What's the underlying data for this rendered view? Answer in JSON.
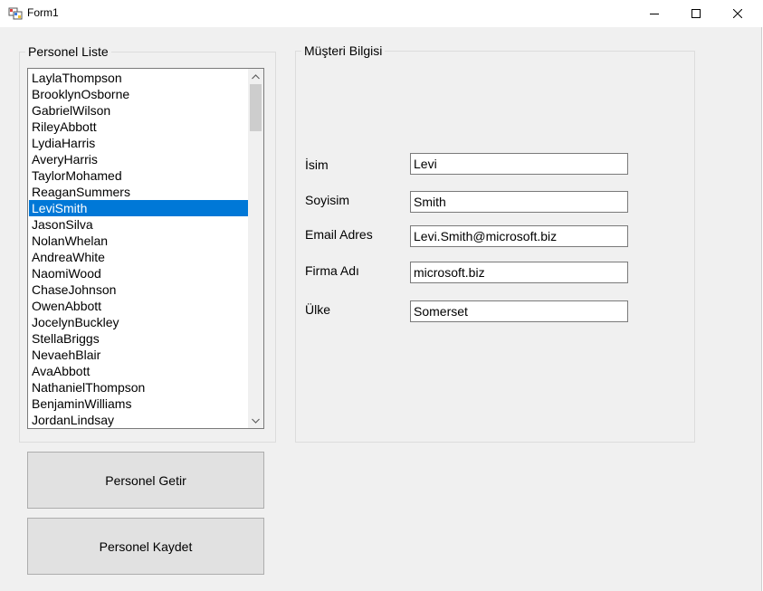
{
  "window": {
    "title": "Form1"
  },
  "personel_group": {
    "label": "Personel Liste",
    "items": [
      "LaylaThompson",
      "BrooklynOsborne",
      "GabrielWilson",
      "RileyAbbott",
      "LydiaHarris",
      "AveryHarris",
      "TaylorMohamed",
      "ReaganSummers",
      "LeviSmith",
      "JasonSilva",
      "NolanWhelan",
      "AndreaWhite",
      "NaomiWood",
      "ChaseJohnson",
      "OwenAbbott",
      "JocelynBuckley",
      "StellaBriggs",
      "NevaehBlair",
      "AvaAbbott",
      "NathanielThompson",
      "BenjaminWilliams",
      "JordanLindsay"
    ],
    "selected_item": "LeviSmith"
  },
  "musteri_group": {
    "label": "Müşteri Bilgisi",
    "fields": {
      "isim": {
        "label": "İsim",
        "value": "Levi"
      },
      "soyisim": {
        "label": "Soyisim",
        "value": "Smith"
      },
      "email": {
        "label": "Email Adres",
        "value": "Levi.Smith@microsoft.biz"
      },
      "firma": {
        "label": "Firma Adı",
        "value": "microsoft.biz"
      },
      "ulke": {
        "label": "Ülke",
        "value": "Somerset"
      }
    }
  },
  "buttons": {
    "getir": "Personel Getir",
    "kaydet": "Personel Kaydet"
  },
  "colors": {
    "selection": "#0078d7",
    "window_bg": "#f0f0f0",
    "button_bg": "#e1e1e1"
  }
}
